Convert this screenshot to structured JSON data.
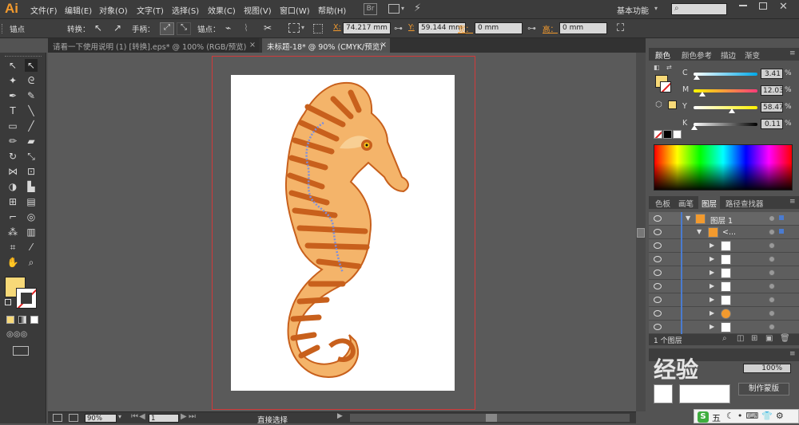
{
  "app": {
    "logo": "Ai"
  },
  "menu": {
    "items": [
      "文件(F)",
      "编辑(E)",
      "对象(O)",
      "文字(T)",
      "选择(S)",
      "效果(C)",
      "视图(V)",
      "窗口(W)",
      "帮助(H)"
    ],
    "br_label": "Br",
    "workspace": "基本功能"
  },
  "control": {
    "anchor_label": "锚点",
    "convert_label": "转换：",
    "handle_label": "手柄：",
    "anchor2_label": "锚点：",
    "x_label": "X:",
    "x_value": "74.217 mm",
    "y_label": "Y:",
    "y_value": "59.144 mm",
    "w_label": "宽：",
    "w_value": "0 mm",
    "h_label": "高：",
    "h_value": "0 mm"
  },
  "tabs": [
    {
      "label": "请看一下使用说明 (1) [转换].eps* @ 100% (RGB/预览)",
      "close": "×"
    },
    {
      "label": "未标题-18* @ 90% (CMYK/预览)",
      "close": "×"
    }
  ],
  "colors": {
    "fill": "#f7d978",
    "accent": "#f29a2e",
    "artboard_border": "#d23a3a",
    "seahorse_dark": "#c8601c",
    "seahorse_light": "#f4b46a",
    "path_selection": "#7b8fe0"
  },
  "status": {
    "zoom": "90%",
    "page": "1",
    "tool": "直接选择"
  },
  "color_panel": {
    "tabs": [
      "颜色",
      "颜色参考",
      "描边",
      "渐变"
    ],
    "channels": [
      {
        "label": "C",
        "value": "3.41",
        "pct": 3.41
      },
      {
        "label": "M",
        "value": "12.03",
        "pct": 12.03
      },
      {
        "label": "Y",
        "value": "58.47",
        "pct": 58.47
      },
      {
        "label": "K",
        "value": "0.11",
        "pct": 0.11
      }
    ]
  },
  "layers_panel": {
    "tabs": [
      "色板",
      "画笔",
      "图层",
      "路径查找器"
    ],
    "layer_name": "图层 1",
    "group_name": "<...",
    "count": "1 个图层",
    "sub_items": 7
  },
  "transparency": {
    "opacity": "100%",
    "make_mask": "制作蒙版"
  },
  "watermark": "经验",
  "taskbar": {
    "ime": "五"
  }
}
